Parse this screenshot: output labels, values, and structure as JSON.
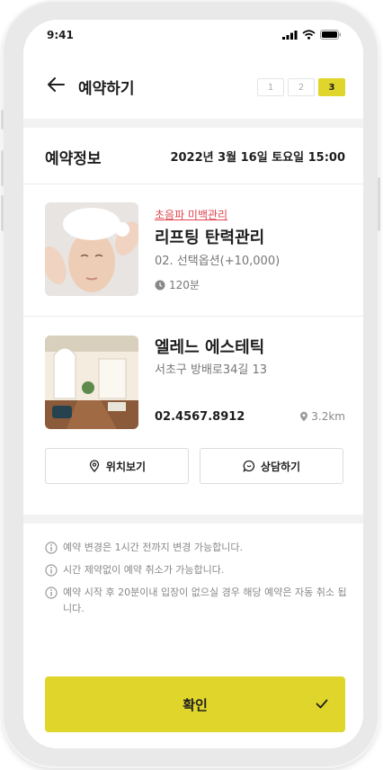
{
  "status_bar": {
    "time": "9:41"
  },
  "header": {
    "title": "예약하기",
    "steps": [
      "1",
      "2",
      "3"
    ],
    "active_step": 3
  },
  "reservation": {
    "title": "예약정보",
    "datetime": "2022년 3월 16일 토요일 15:00"
  },
  "service": {
    "category": "초음파 미백관리",
    "name": "리프팅 탄력관리",
    "option": "02. 선택옵션(+10,000)",
    "duration": "120분"
  },
  "shop": {
    "name": "엘레느 에스테틱",
    "address": "서초구 방배로34길 13",
    "phone": "02.4567.8912",
    "distance": "3.2km",
    "location_button": "위치보기",
    "consult_button": "상담하기"
  },
  "notices": [
    "예약 변경은 1시간 전까지 변경 가능합니다.",
    "시간 제약없이 예약 취소가 가능합니다.",
    "예약 시작 후 20분이내 입장이 없으실 경우 해당 예약은 자동 취소 됩니다."
  ],
  "confirm_button": "확인",
  "colors": {
    "accent": "#dfd52b",
    "category": "#e0444f",
    "muted": "#777777"
  }
}
